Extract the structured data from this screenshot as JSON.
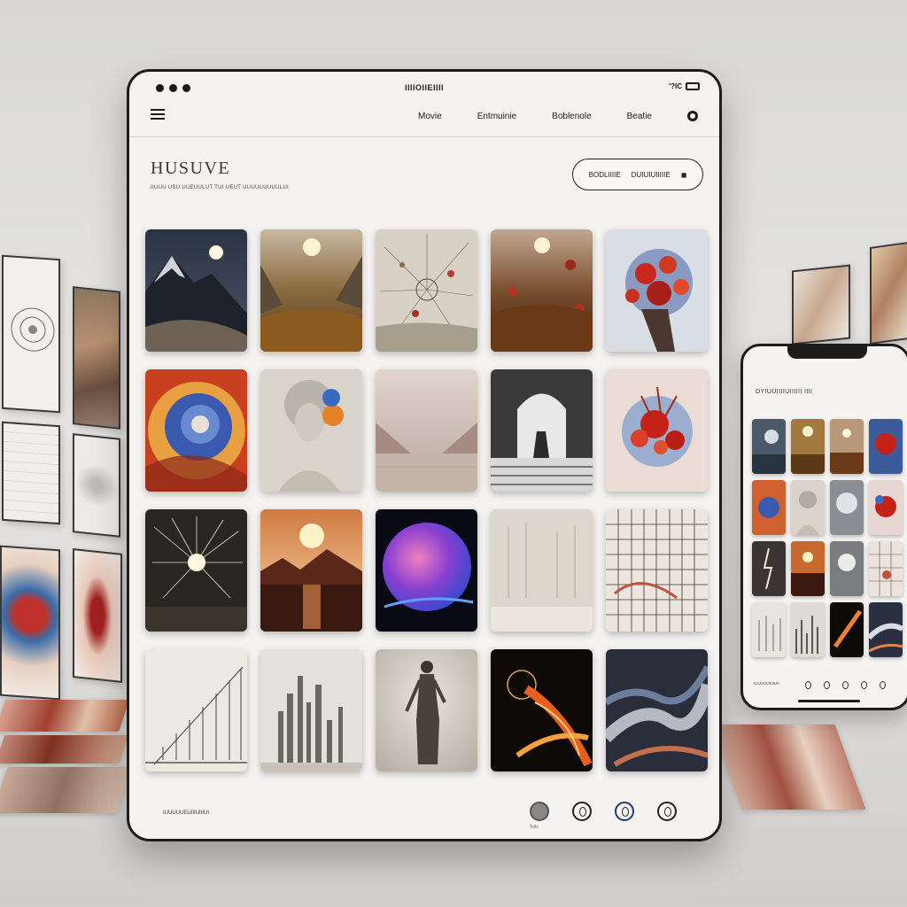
{
  "tablet": {
    "status": {
      "center_text": "IIIIOIIEIIII",
      "right_text": "'?IC"
    },
    "nav": {
      "links": [
        "Movie",
        "Entmuinie",
        "Boblenole",
        "Beatie"
      ]
    },
    "hero": {
      "title": "HUSUVE",
      "subtitle": "IIUUU USU UUEUULUT TUI UEUT UUUUUUUUULUI"
    },
    "cta": {
      "label_left": "BODLIIIIE",
      "label_right": "DUIUIUIIIIIE"
    },
    "footer": {
      "text": "IUUUUUEUIIIUIIIUI",
      "home_indicator": "'IUU"
    },
    "artworks": [
      "mountain-moon",
      "golden-valley-sun",
      "dandelion-flowers",
      "autumn-meadow-sun",
      "red-flower-bouquet",
      "colorful-swirl",
      "portrait-bust",
      "minimal-valley",
      "archway-figure",
      "flower-explosion",
      "firework-burst",
      "sunset-mountains",
      "nebula-sphere",
      "misty-forest",
      "grid-collage",
      "fence-sketch",
      "city-sketch",
      "standing-figure",
      "fire-vortex",
      "smoke-flow"
    ]
  },
  "phone": {
    "title": "DYIUUIIIIUIIIIII IIII",
    "footer_text": "IUUUUUEIIUII",
    "artworks": [
      "storm-sea",
      "golden-light",
      "autumn-glow",
      "red-bouquet",
      "color-swirl",
      "portrait",
      "gray-sphere",
      "flower-burst",
      "lightning",
      "sunset",
      "moon-orb",
      "grid-panels",
      "forest-sketch",
      "city-sketch",
      "fire-arc",
      "smoke-blue"
    ]
  },
  "colors": {
    "frame": "#1c1c1c",
    "surface": "#f4f3f0",
    "wall": "#e0dfdc"
  }
}
